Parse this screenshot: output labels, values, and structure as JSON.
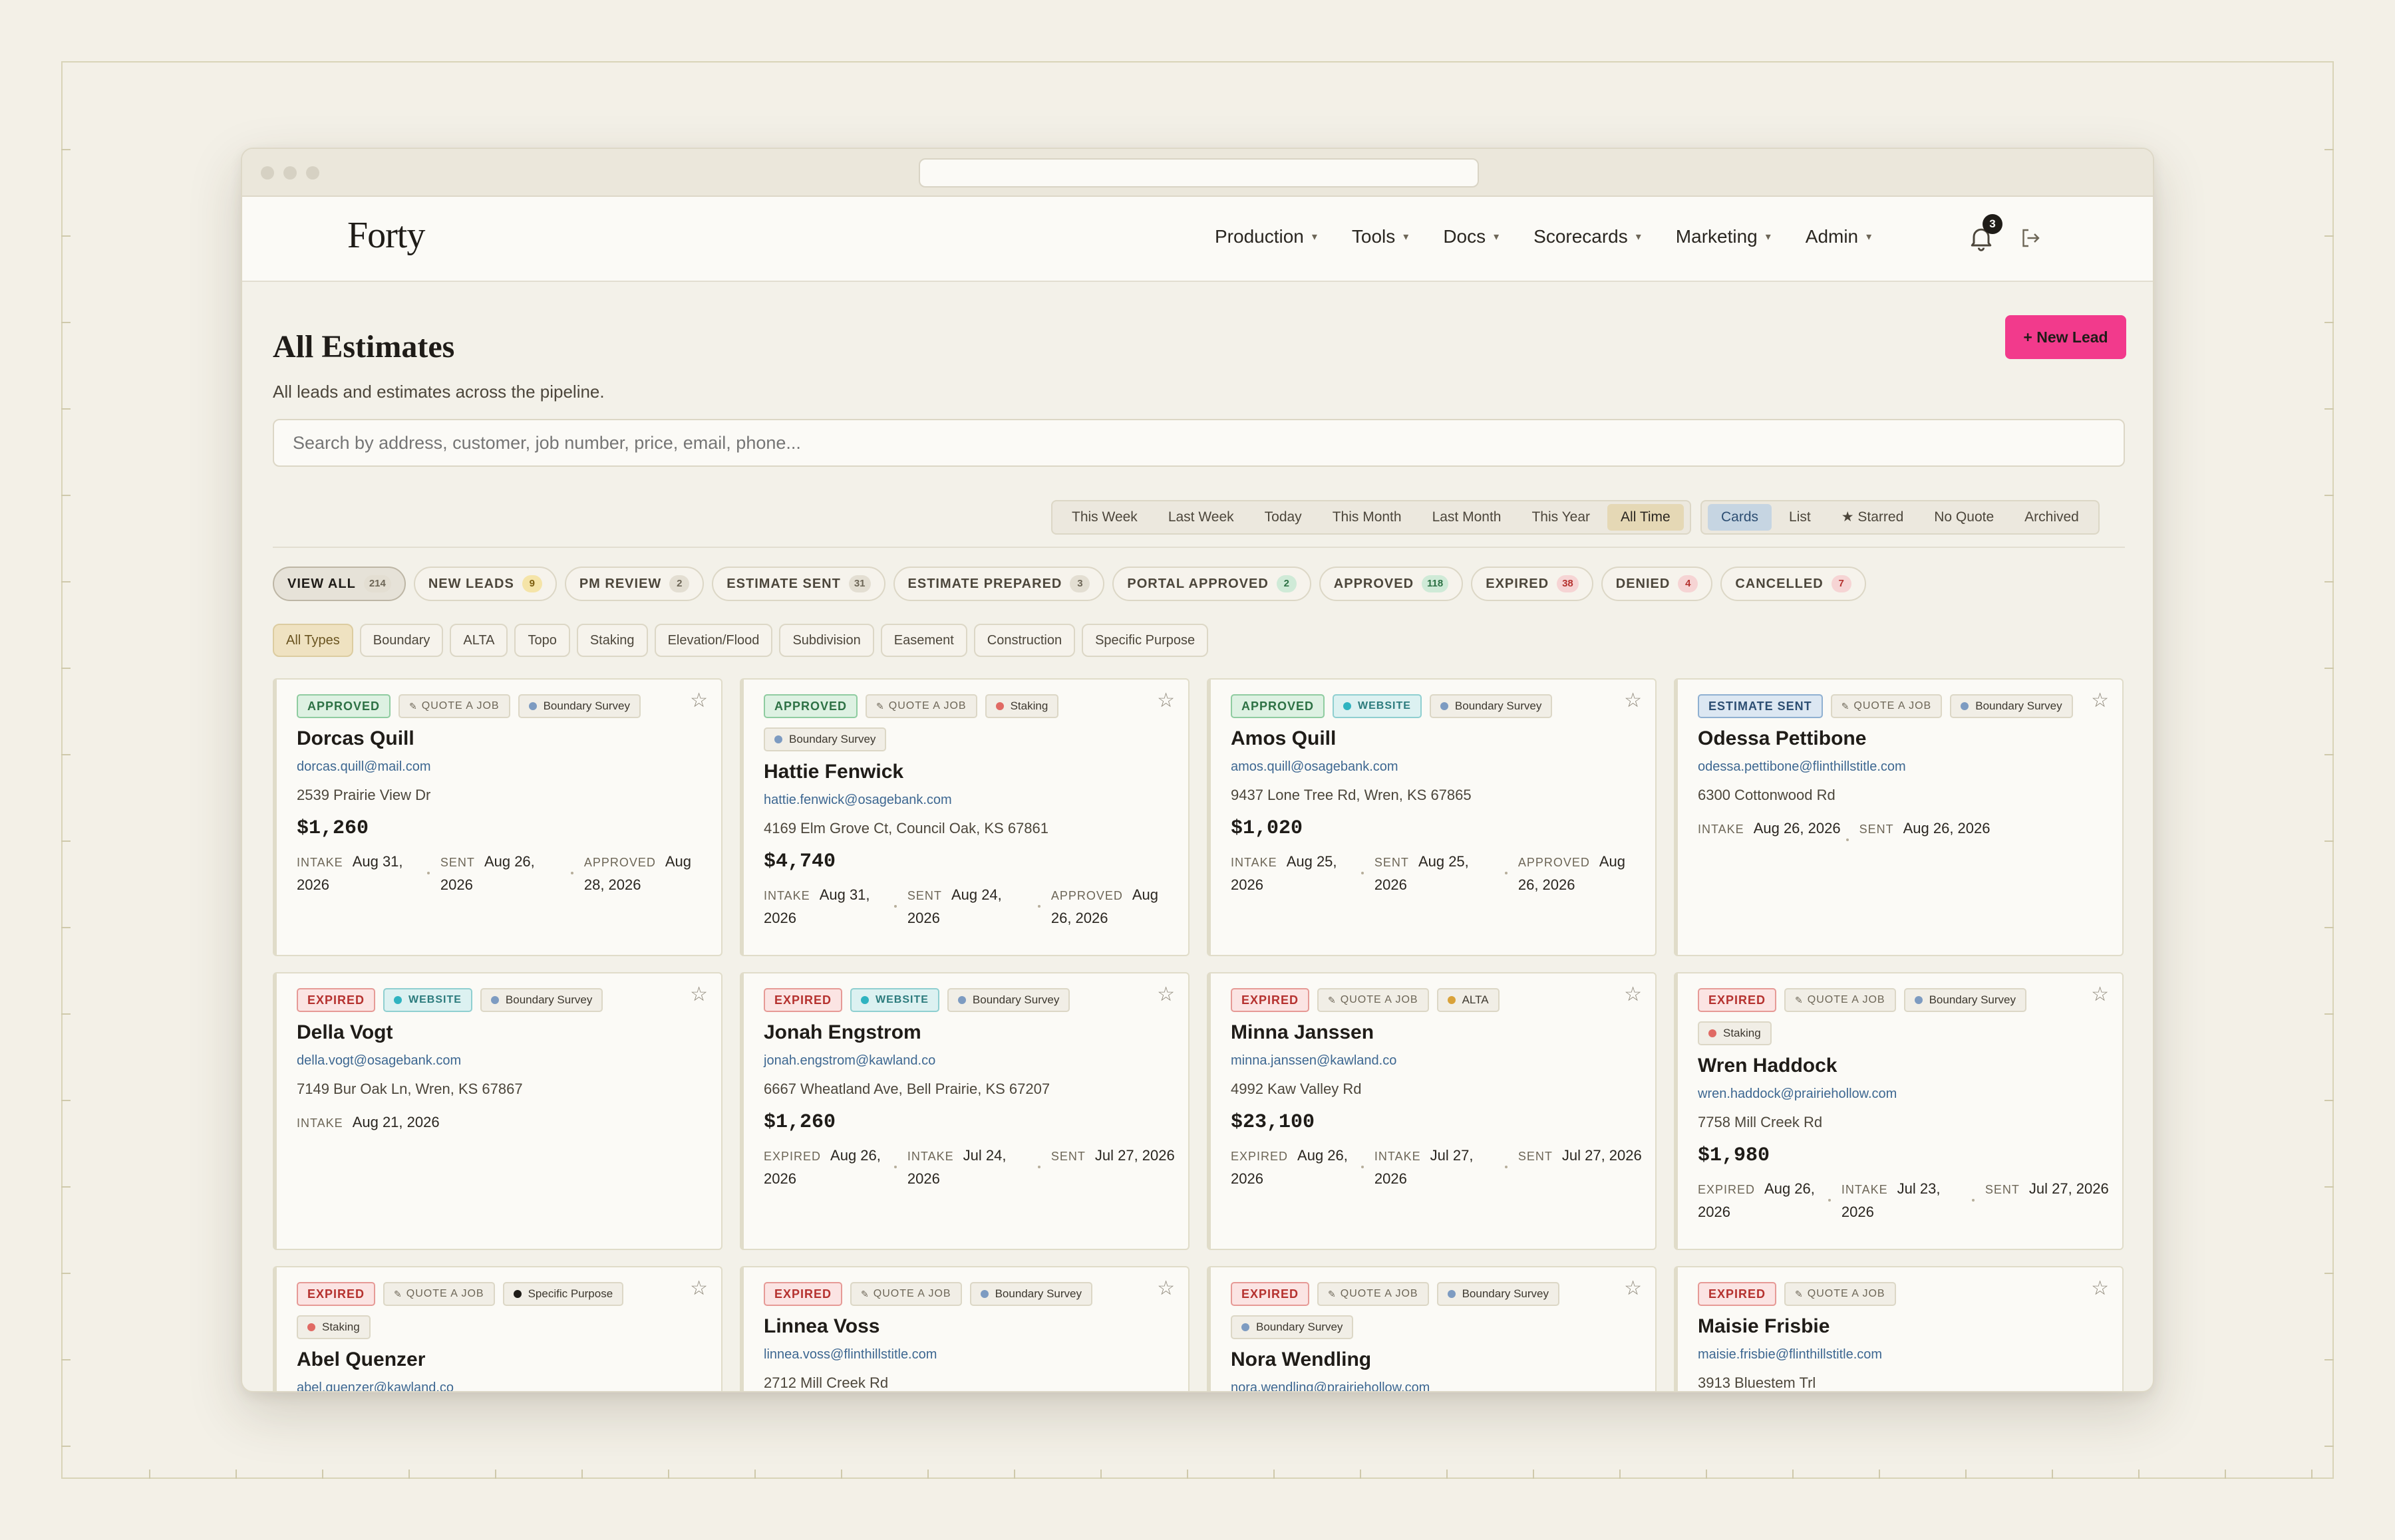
{
  "app": {
    "logo": "Forty",
    "nav": [
      "Production",
      "Tools",
      "Docs",
      "Scorecards",
      "Marketing",
      "Admin"
    ],
    "notification_count": "3"
  },
  "page": {
    "title": "All Estimates",
    "subtitle": "All leads and estimates across the pipeline.",
    "new_lead_label": "+ New Lead",
    "search_placeholder": "Search by address, customer, job number, price, email, phone..."
  },
  "time_filters": [
    "This Week",
    "Last Week",
    "Today",
    "This Month",
    "Last Month",
    "This Year",
    "All Time"
  ],
  "time_filter_active": "All Time",
  "view_filters": [
    "Cards",
    "List",
    "★ Starred",
    "No Quote",
    "Archived"
  ],
  "view_filter_active": "Cards",
  "status_filters": [
    {
      "label": "VIEW ALL",
      "count": "214",
      "tone": "grey"
    },
    {
      "label": "NEW LEADS",
      "count": "9",
      "tone": "yellow"
    },
    {
      "label": "PM REVIEW",
      "count": "2",
      "tone": "grey"
    },
    {
      "label": "ESTIMATE SENT",
      "count": "31",
      "tone": "grey"
    },
    {
      "label": "ESTIMATE PREPARED",
      "count": "3",
      "tone": "grey"
    },
    {
      "label": "PORTAL APPROVED",
      "count": "2",
      "tone": "green"
    },
    {
      "label": "APPROVED",
      "count": "118",
      "tone": "green"
    },
    {
      "label": "EXPIRED",
      "count": "38",
      "tone": "red"
    },
    {
      "label": "DENIED",
      "count": "4",
      "tone": "red"
    },
    {
      "label": "CANCELLED",
      "count": "7",
      "tone": "red"
    }
  ],
  "type_filters": [
    "All Types",
    "Boundary",
    "ALTA",
    "Topo",
    "Staking",
    "Elevation/Flood",
    "Subdivision",
    "Easement",
    "Construction",
    "Specific Purpose"
  ],
  "colors": {
    "accent": "#f23a8c",
    "approved": "#2d7144",
    "expired": "#b5322f",
    "sent": "#2d4e72",
    "boundary_dot": "#7d9bc1",
    "staking_dot": "#e06a64",
    "alta_dot": "#d9a23a",
    "specific_dot": "#1f1c18",
    "website_dot": "#2fb3c0"
  },
  "cards": [
    {
      "status": "APPROVED",
      "status_kind": "approved",
      "source": "QUOTE A JOB",
      "source_kind": "quote",
      "types": [
        {
          "label": "Boundary Survey",
          "dot": "#7d9bc1"
        }
      ],
      "name": "Dorcas Quill",
      "email": "dorcas.quill@mail.com",
      "address": "2539 Prairie View Dr",
      "price": "$1,260",
      "dates": [
        {
          "label": "INTAKE",
          "value": "Aug 31, 2026"
        },
        {
          "label": "SENT",
          "value": "Aug 26, 2026"
        },
        {
          "label": "APPROVED",
          "value": "Aug 28, 2026"
        }
      ]
    },
    {
      "status": "APPROVED",
      "status_kind": "approved",
      "source": "QUOTE A JOB",
      "source_kind": "quote",
      "types": [
        {
          "label": "Staking",
          "dot": "#e06a64"
        },
        {
          "label": "Boundary Survey",
          "dot": "#7d9bc1"
        }
      ],
      "name": "Hattie Fenwick",
      "email": "hattie.fenwick@osagebank.com",
      "address": "4169 Elm Grove Ct, Council Oak, KS 67861",
      "price": "$4,740",
      "dates": [
        {
          "label": "INTAKE",
          "value": "Aug 31, 2026"
        },
        {
          "label": "SENT",
          "value": "Aug 24, 2026"
        },
        {
          "label": "APPROVED",
          "value": "Aug 26, 2026"
        }
      ]
    },
    {
      "status": "APPROVED",
      "status_kind": "approved",
      "source": "WEBSITE",
      "source_kind": "web",
      "types": [
        {
          "label": "Boundary Survey",
          "dot": "#7d9bc1"
        }
      ],
      "name": "Amos Quill",
      "email": "amos.quill@osagebank.com",
      "address": "9437 Lone Tree Rd, Wren, KS 67865",
      "price": "$1,020",
      "dates": [
        {
          "label": "INTAKE",
          "value": "Aug 25, 2026"
        },
        {
          "label": "SENT",
          "value": "Aug 25, 2026"
        },
        {
          "label": "APPROVED",
          "value": "Aug 26, 2026"
        }
      ]
    },
    {
      "status": "ESTIMATE SENT",
      "status_kind": "sent",
      "source": "QUOTE A JOB",
      "source_kind": "quote",
      "types": [
        {
          "label": "Boundary Survey",
          "dot": "#7d9bc1"
        }
      ],
      "name": "Odessa Pettibone",
      "email": "odessa.pettibone@flinthillstitle.com",
      "address": "6300 Cottonwood Rd",
      "price": "",
      "dates": [
        {
          "label": "INTAKE",
          "value": "Aug 26, 2026"
        },
        {
          "label": "SENT",
          "value": "Aug 26, 2026"
        }
      ]
    },
    {
      "status": "EXPIRED",
      "status_kind": "expired",
      "source": "WEBSITE",
      "source_kind": "web",
      "types": [
        {
          "label": "Boundary Survey",
          "dot": "#7d9bc1"
        }
      ],
      "name": "Della Vogt",
      "email": "della.vogt@osagebank.com",
      "address": "7149 Bur Oak Ln, Wren, KS 67867",
      "price": "",
      "dates": [
        {
          "label": "INTAKE",
          "value": "Aug 21, 2026"
        }
      ]
    },
    {
      "status": "EXPIRED",
      "status_kind": "expired",
      "source": "WEBSITE",
      "source_kind": "web",
      "types": [
        {
          "label": "Boundary Survey",
          "dot": "#7d9bc1"
        }
      ],
      "name": "Jonah Engstrom",
      "email": "jonah.engstrom@kawland.co",
      "address": "6667 Wheatland Ave, Bell Prairie, KS 67207",
      "price": "$1,260",
      "dates": [
        {
          "label": "EXPIRED",
          "value": "Aug 26, 2026"
        },
        {
          "label": "INTAKE",
          "value": "Jul 24, 2026"
        },
        {
          "label": "SENT",
          "value": "Jul 27, 2026"
        }
      ]
    },
    {
      "status": "EXPIRED",
      "status_kind": "expired",
      "source": "QUOTE A JOB",
      "source_kind": "quote",
      "types": [
        {
          "label": "ALTA",
          "dot": "#d9a23a"
        }
      ],
      "name": "Minna Janssen",
      "email": "minna.janssen@kawland.co",
      "address": "4992 Kaw Valley Rd",
      "price": "$23,100",
      "dates": [
        {
          "label": "EXPIRED",
          "value": "Aug 26, 2026"
        },
        {
          "label": "INTAKE",
          "value": "Jul 27, 2026"
        },
        {
          "label": "SENT",
          "value": "Jul 27, 2026"
        }
      ]
    },
    {
      "status": "EXPIRED",
      "status_kind": "expired",
      "source": "QUOTE A JOB",
      "source_kind": "quote",
      "types": [
        {
          "label": "Boundary Survey",
          "dot": "#7d9bc1"
        },
        {
          "label": "Staking",
          "dot": "#e06a64"
        }
      ],
      "name": "Wren Haddock",
      "email": "wren.haddock@prairiehollow.com",
      "address": "7758 Mill Creek Rd",
      "price": "$1,980",
      "dates": [
        {
          "label": "EXPIRED",
          "value": "Aug 26, 2026"
        },
        {
          "label": "INTAKE",
          "value": "Jul 23, 2026"
        },
        {
          "label": "SENT",
          "value": "Jul 27, 2026"
        }
      ]
    },
    {
      "status": "EXPIRED",
      "status_kind": "expired",
      "source": "QUOTE A JOB",
      "source_kind": "quote",
      "types": [
        {
          "label": "Specific Purpose",
          "dot": "#1f1c18"
        },
        {
          "label": "Staking",
          "dot": "#e06a64"
        }
      ],
      "name": "Abel Quenzer",
      "email": "abel.quenzer@kawland.co",
      "address": "",
      "price": "",
      "dates": []
    },
    {
      "status": "EXPIRED",
      "status_kind": "expired",
      "source": "QUOTE A JOB",
      "source_kind": "quote",
      "types": [
        {
          "label": "Boundary Survey",
          "dot": "#7d9bc1"
        }
      ],
      "name": "Linnea Voss",
      "email": "linnea.voss@flinthillstitle.com",
      "address": "2712 Mill Creek Rd",
      "price": "",
      "dates": []
    },
    {
      "status": "EXPIRED",
      "status_kind": "expired",
      "source": "QUOTE A JOB",
      "source_kind": "quote",
      "types": [
        {
          "label": "Boundary Survey",
          "dot": "#7d9bc1"
        },
        {
          "label": "Boundary Survey",
          "dot": "#7d9bc1"
        }
      ],
      "name": "Nora Wendling",
      "email": "nora.wendling@prairiehollow.com",
      "address": "",
      "price": "",
      "dates": []
    },
    {
      "status": "EXPIRED",
      "status_kind": "expired",
      "source": "QUOTE A JOB",
      "source_kind": "quote",
      "types": [],
      "name": "Maisie Frisbie",
      "email": "maisie.frisbie@flinthillstitle.com",
      "address": "3913 Bluestem Trl",
      "price": "",
      "dates": []
    }
  ]
}
